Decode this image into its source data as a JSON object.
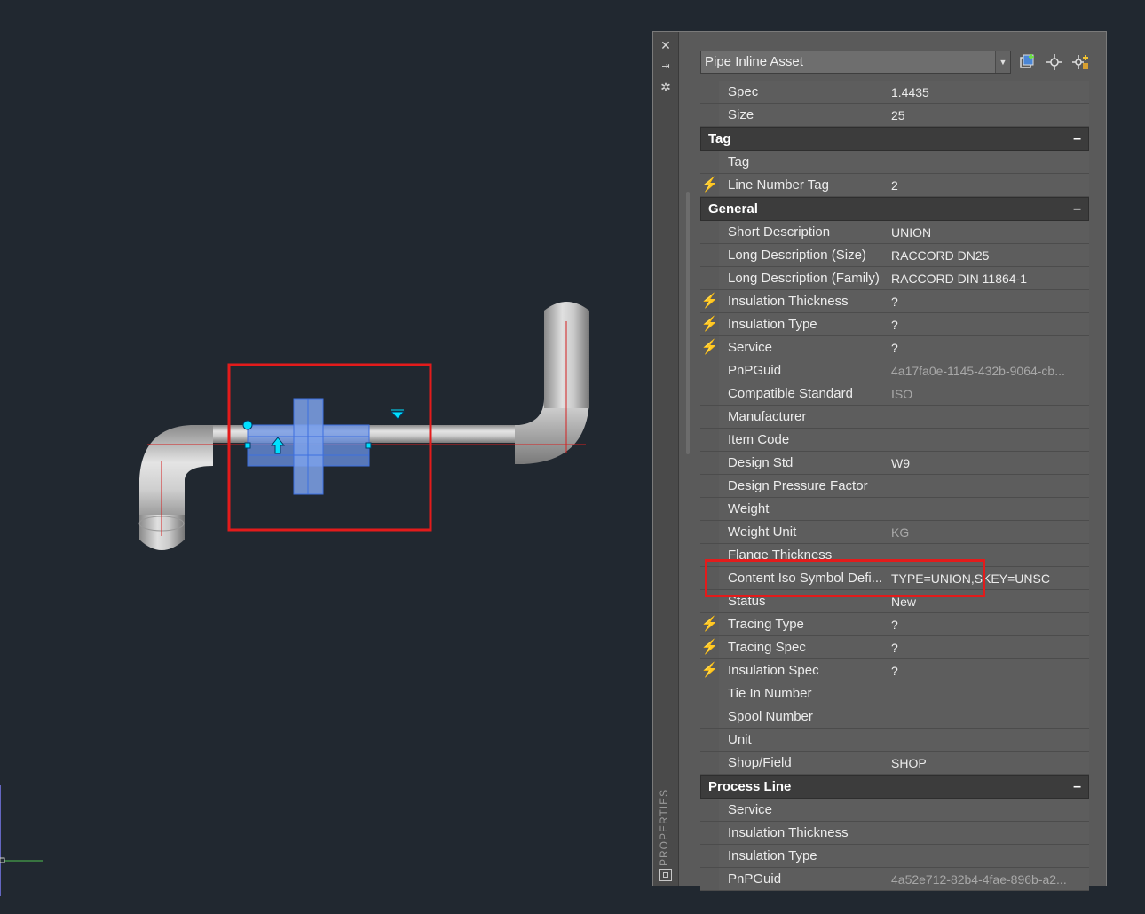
{
  "viewport": {
    "accent_red": "#e31b1b",
    "pipe_color": "#c9c9c9",
    "selection_color": "#5a8dea"
  },
  "palette": {
    "side_label": "PROPERTIES",
    "strip_icons": [
      "close-icon",
      "autohide-icon",
      "settings-icon",
      "palette-properties-icon"
    ],
    "object_type": "Pipe Inline Asset",
    "toolbar_icons": [
      "quick-select-icon",
      "select-objects-icon",
      "toggle-pickadd-icon"
    ],
    "sections": [
      {
        "rows": [
          {
            "name": "Spec",
            "value": "1.4435",
            "lightning": false
          },
          {
            "name": "Size",
            "value": "25",
            "lightning": false
          }
        ]
      },
      {
        "title": "Tag",
        "toggle": "–",
        "rows": [
          {
            "name": "Tag",
            "value": "",
            "lightning": false
          },
          {
            "name": "Line Number Tag",
            "value": "2",
            "lightning": true
          }
        ]
      },
      {
        "title": "General",
        "toggle": "–",
        "rows": [
          {
            "name": "Short Description",
            "value": "UNION",
            "lightning": false
          },
          {
            "name": "Long Description (Size)",
            "value": "RACCORD DN25",
            "lightning": false
          },
          {
            "name": "Long Description (Family)",
            "value": "RACCORD DIN 11864-1",
            "lightning": false
          },
          {
            "name": "Insulation Thickness",
            "value": "?",
            "lightning": true
          },
          {
            "name": "Insulation Type",
            "value": "?",
            "lightning": true
          },
          {
            "name": "Service",
            "value": "?",
            "lightning": true
          },
          {
            "name": "PnPGuid",
            "value": "4a17fa0e-1145-432b-9064-cb...",
            "lightning": false,
            "readonly": true
          },
          {
            "name": "Compatible Standard",
            "value": "ISO",
            "lightning": false,
            "readonly": true
          },
          {
            "name": "Manufacturer",
            "value": "",
            "lightning": false
          },
          {
            "name": "Item Code",
            "value": "",
            "lightning": false
          },
          {
            "name": "Design Std",
            "value": "W9",
            "lightning": false
          },
          {
            "name": "Design Pressure Factor",
            "value": "",
            "lightning": false
          },
          {
            "name": "Weight",
            "value": "",
            "lightning": false
          },
          {
            "name": "Weight Unit",
            "value": "KG",
            "lightning": false,
            "readonly": true
          },
          {
            "name": "Flange Thickness",
            "value": "",
            "lightning": false
          },
          {
            "name": "Content Iso Symbol Defi...",
            "value": "TYPE=UNION,SKEY=UNSC",
            "lightning": false,
            "highlight": true
          },
          {
            "name": "Status",
            "value": "New",
            "lightning": false
          },
          {
            "name": "Tracing Type",
            "value": "?",
            "lightning": true
          },
          {
            "name": "Tracing Spec",
            "value": "?",
            "lightning": true
          },
          {
            "name": "Insulation Spec",
            "value": "?",
            "lightning": true
          },
          {
            "name": "Tie In Number",
            "value": "",
            "lightning": false
          },
          {
            "name": "Spool Number",
            "value": "",
            "lightning": false
          },
          {
            "name": "Unit",
            "value": "",
            "lightning": false
          },
          {
            "name": "Shop/Field",
            "value": "SHOP",
            "lightning": false
          }
        ]
      },
      {
        "title": "Process Line",
        "toggle": "–",
        "rows": [
          {
            "name": "Service",
            "value": "",
            "lightning": false
          },
          {
            "name": "Insulation Thickness",
            "value": "",
            "lightning": false
          },
          {
            "name": "Insulation Type",
            "value": "",
            "lightning": false
          },
          {
            "name": "PnPGuid",
            "value": "4a52e712-82b4-4fae-896b-a2...",
            "lightning": false,
            "readonly": true
          }
        ]
      }
    ]
  }
}
